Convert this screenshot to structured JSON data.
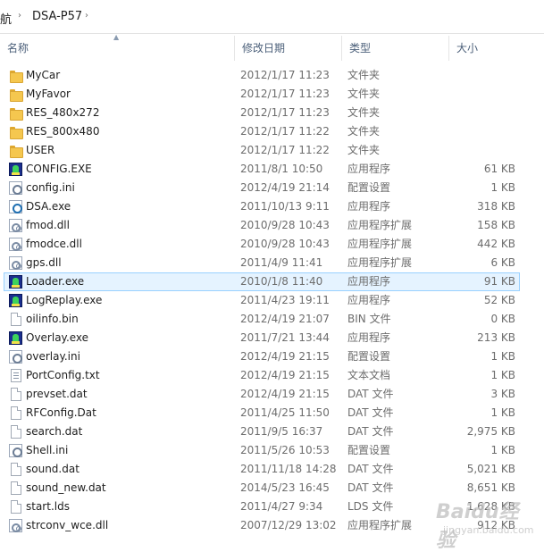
{
  "breadcrumb": {
    "root_label": "航",
    "folder_label": "DSA-P57",
    "separator": "›"
  },
  "columns": {
    "name": "名称",
    "date": "修改日期",
    "type": "类型",
    "size": "大小"
  },
  "files": [
    {
      "name": "MyCar",
      "date": "2012/1/17 11:23",
      "type": "文件夹",
      "size": "",
      "icon": "folder-icon"
    },
    {
      "name": "MyFavor",
      "date": "2012/1/17 11:23",
      "type": "文件夹",
      "size": "",
      "icon": "folder-icon"
    },
    {
      "name": "RES_480x272",
      "date": "2012/1/17 11:23",
      "type": "文件夹",
      "size": "",
      "icon": "folder-icon"
    },
    {
      "name": "RES_800x480",
      "date": "2012/1/17 11:22",
      "type": "文件夹",
      "size": "",
      "icon": "folder-icon"
    },
    {
      "name": "USER",
      "date": "2012/1/17 11:22",
      "type": "文件夹",
      "size": "",
      "icon": "folder-icon"
    },
    {
      "name": "CONFIG.EXE",
      "date": "2011/8/1 10:50",
      "type": "应用程序",
      "size": "61 KB",
      "icon": "exe-icon"
    },
    {
      "name": "config.ini",
      "date": "2012/4/19 21:14",
      "type": "配置设置",
      "size": "1 KB",
      "icon": "ini-icon"
    },
    {
      "name": "DSA.exe",
      "date": "2011/10/13 9:11",
      "type": "应用程序",
      "size": "318 KB",
      "icon": "dsa-icon"
    },
    {
      "name": "fmod.dll",
      "date": "2010/9/28 10:43",
      "type": "应用程序扩展",
      "size": "158 KB",
      "icon": "dll-icon"
    },
    {
      "name": "fmodce.dll",
      "date": "2010/9/28 10:43",
      "type": "应用程序扩展",
      "size": "442 KB",
      "icon": "dll-icon"
    },
    {
      "name": "gps.dll",
      "date": "2011/4/9 11:41",
      "type": "应用程序扩展",
      "size": "6 KB",
      "icon": "dll-icon"
    },
    {
      "name": "Loader.exe",
      "date": "2010/1/8 11:40",
      "type": "应用程序",
      "size": "91 KB",
      "icon": "exe-icon",
      "selected": true
    },
    {
      "name": "LogReplay.exe",
      "date": "2011/4/23 19:11",
      "type": "应用程序",
      "size": "52 KB",
      "icon": "exe-icon"
    },
    {
      "name": "oilinfo.bin",
      "date": "2012/4/19 21:07",
      "type": "BIN 文件",
      "size": "0 KB",
      "icon": "file-icon"
    },
    {
      "name": "Overlay.exe",
      "date": "2011/7/21 13:44",
      "type": "应用程序",
      "size": "213 KB",
      "icon": "exe-icon"
    },
    {
      "name": "overlay.ini",
      "date": "2012/4/19 21:15",
      "type": "配置设置",
      "size": "1 KB",
      "icon": "ini-icon"
    },
    {
      "name": "PortConfig.txt",
      "date": "2012/4/19 21:15",
      "type": "文本文档",
      "size": "1 KB",
      "icon": "txt-icon"
    },
    {
      "name": "prevset.dat",
      "date": "2012/4/19 21:15",
      "type": "DAT 文件",
      "size": "3 KB",
      "icon": "file-icon"
    },
    {
      "name": "RFConfig.Dat",
      "date": "2011/4/25 11:50",
      "type": "DAT 文件",
      "size": "1 KB",
      "icon": "file-icon"
    },
    {
      "name": "search.dat",
      "date": "2011/9/5 16:37",
      "type": "DAT 文件",
      "size": "2,975 KB",
      "icon": "file-icon"
    },
    {
      "name": "Shell.ini",
      "date": "2011/5/26 10:53",
      "type": "配置设置",
      "size": "1 KB",
      "icon": "ini-icon"
    },
    {
      "name": "sound.dat",
      "date": "2011/11/18 14:28",
      "type": "DAT 文件",
      "size": "5,021 KB",
      "icon": "file-icon"
    },
    {
      "name": "sound_new.dat",
      "date": "2014/5/23 16:45",
      "type": "DAT 文件",
      "size": "8,651 KB",
      "icon": "file-icon"
    },
    {
      "name": "start.lds",
      "date": "2011/4/27 9:34",
      "type": "LDS 文件",
      "size": "1,628 KB",
      "icon": "file-icon"
    },
    {
      "name": "strconv_wce.dll",
      "date": "2007/12/29 13:02",
      "type": "应用程序扩展",
      "size": "912 KB",
      "icon": "dll-icon"
    }
  ],
  "watermark": {
    "logo_text": "Baidu经验",
    "url_text": "jingyan.baidu.com"
  }
}
